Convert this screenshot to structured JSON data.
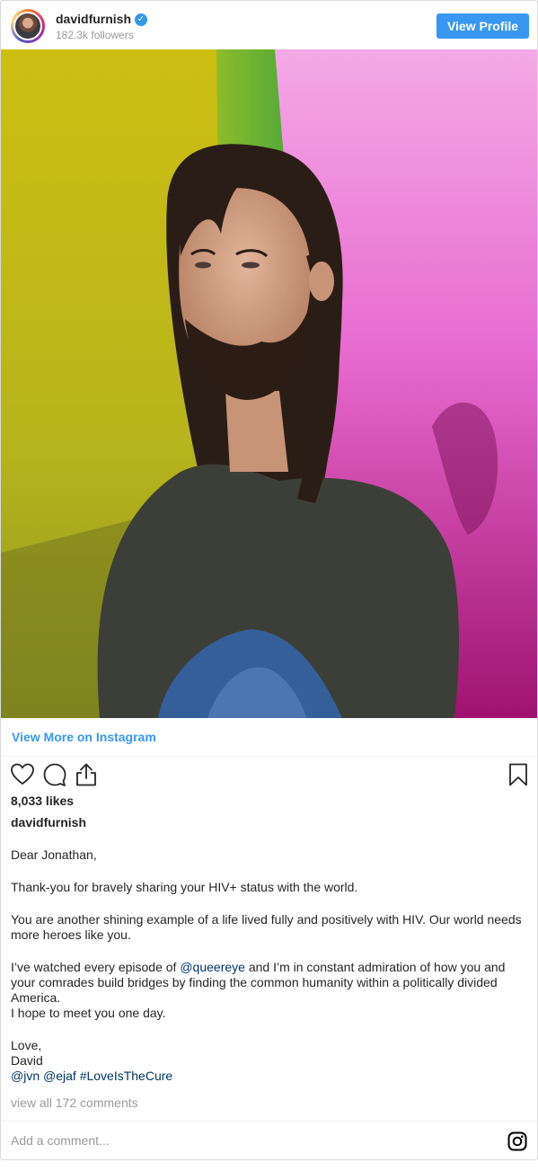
{
  "header": {
    "username": "davidfurnish",
    "followers": "182.3k followers",
    "view_profile_label": "View Profile"
  },
  "post": {
    "view_more_label": "View More on Instagram",
    "likes": "8,033 likes",
    "author": "davidfurnish",
    "caption": {
      "greeting": "Dear Jonathan,",
      "line1": "Thank-you for bravely sharing your HIV+ status with the world.",
      "line2": "You are another shining example of a life lived fully and positively with HIV. Our world needs more heroes like you.",
      "line3_before": "I’ve watched every episode of ",
      "line3_mention": "@queereye",
      "line3_after": " and I’m in constant admiration of how you and your comrades build bridges by finding the common humanity within a politically divided America.",
      "line4": "I hope to meet you one day.",
      "signoff": "Love,",
      "name": "David",
      "tag1": "@jvn",
      "tag2": "@ejaf",
      "tag3": "#LoveIsTheCure"
    },
    "view_comments": "view all 172 comments",
    "comment_placeholder": "Add a comment..."
  },
  "icons": [
    "verified-badge-icon",
    "heart-icon",
    "comment-icon",
    "share-icon",
    "bookmark-icon",
    "instagram-icon"
  ],
  "colors": {
    "accent": "#3897f0",
    "link": "#003569",
    "muted": "#999999"
  }
}
